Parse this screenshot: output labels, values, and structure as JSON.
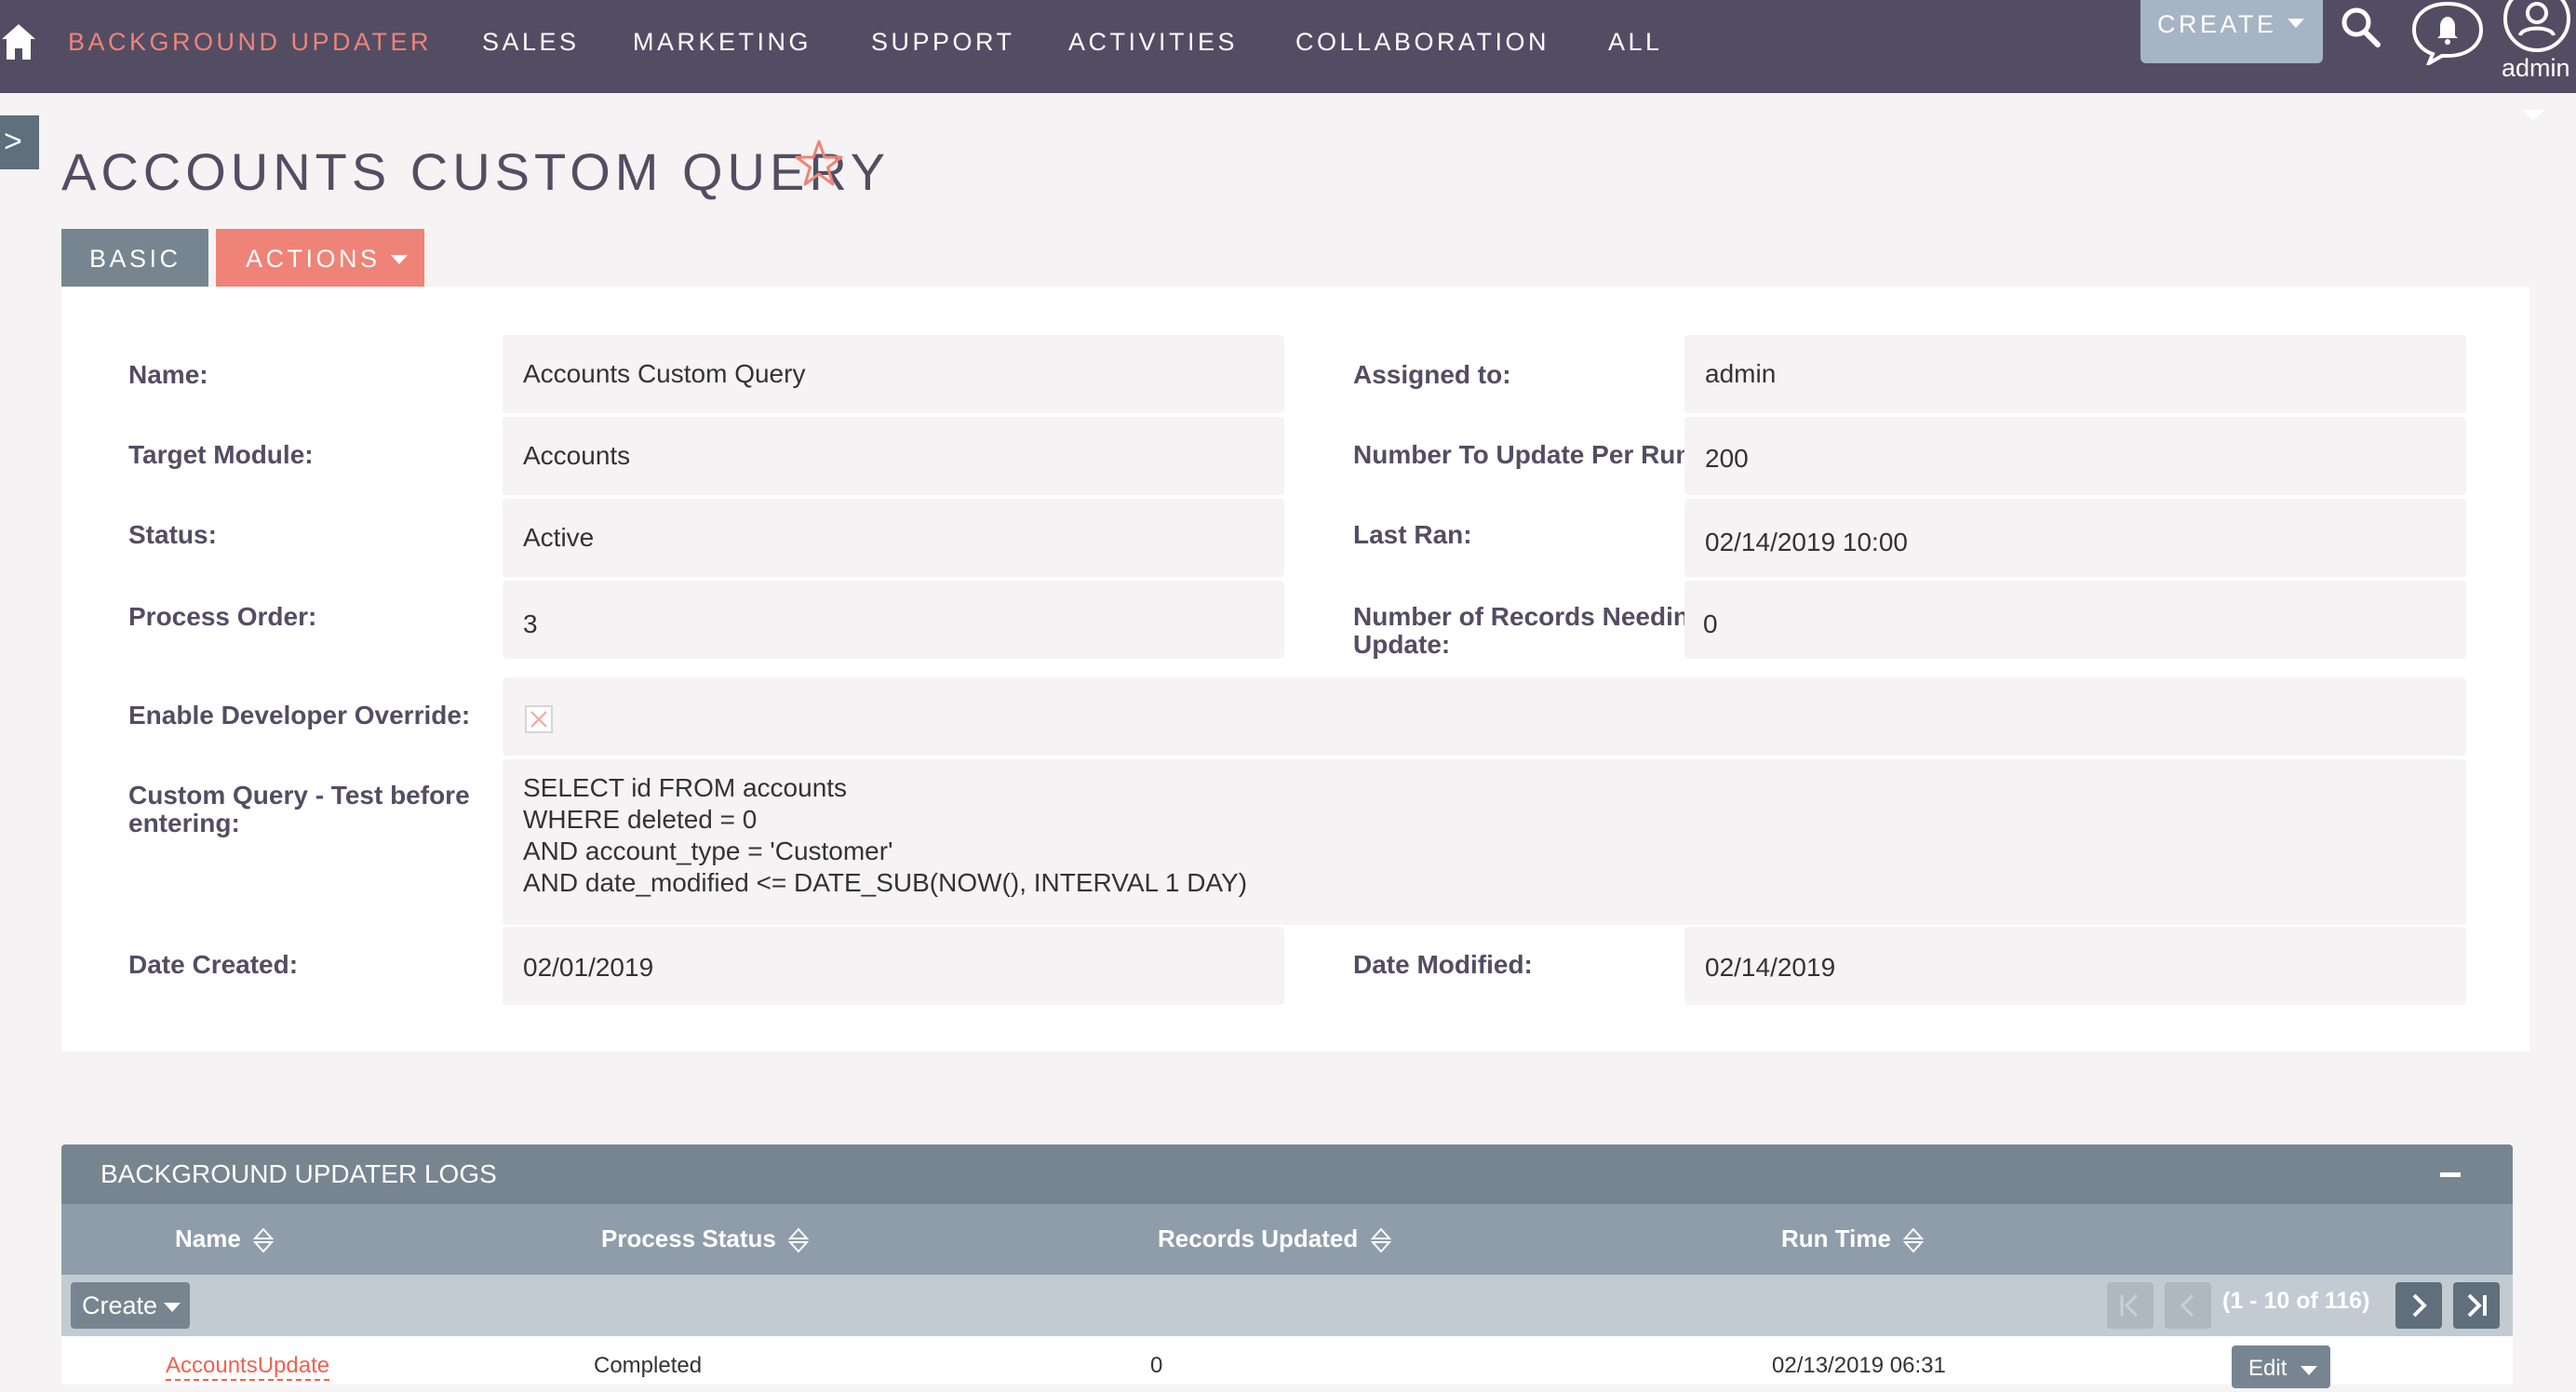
{
  "nav": {
    "items": [
      {
        "label": "BACKGROUND UPDATER",
        "active": true
      },
      {
        "label": "SALES",
        "active": false
      },
      {
        "label": "MARKETING",
        "active": false
      },
      {
        "label": "SUPPORT",
        "active": false
      },
      {
        "label": "ACTIVITIES",
        "active": false
      },
      {
        "label": "COLLABORATION",
        "active": false
      },
      {
        "label": "ALL",
        "active": false
      }
    ],
    "create_label": "CREATE",
    "user_label": "admin",
    "icons": [
      "home-icon",
      "search-icon",
      "notification-bell-icon",
      "user-avatar-icon"
    ]
  },
  "sidebar_toggle": ">",
  "page": {
    "title": "ACCOUNTS CUSTOM QUERY",
    "favorite_icon": "star-outline-icon"
  },
  "tabs": {
    "basic": "BASIC",
    "actions": "ACTIONS"
  },
  "detail": {
    "name_label": "Name:",
    "name_value": "Accounts Custom Query",
    "assigned_label": "Assigned to:",
    "assigned_value": "admin",
    "target_label": "Target Module:",
    "target_value": "Accounts",
    "per_run_label": "Number To Update Per Run:",
    "per_run_value": "200",
    "status_label": "Status:",
    "status_value": "Active",
    "last_ran_label": "Last Ran:",
    "last_ran_value": "02/14/2019 10:00",
    "order_label": "Process Order:",
    "order_value": "3",
    "needing_label_line1": "Number of Records Needing",
    "needing_label_line2": "Update:",
    "needing_value": "0",
    "override_label": "Enable Developer Override:",
    "override_checked": false,
    "query_label_line1": "Custom Query - Test before",
    "query_label_line2": "entering:",
    "query_lines": [
      "SELECT id FROM accounts",
      "WHERE deleted = 0",
      "AND account_type = 'Customer'",
      "AND date_modified <= DATE_SUB(NOW(), INTERVAL 1 DAY)"
    ],
    "created_label": "Date Created:",
    "created_value": "02/01/2019",
    "modified_label": "Date Modified:",
    "modified_value": "02/14/2019"
  },
  "logs": {
    "title": "BACKGROUND UPDATER LOGS",
    "columns": [
      "Name",
      "Process Status",
      "Records Updated",
      "Run Time"
    ],
    "create_label": "Create",
    "pagination": "(1 - 10 of 116)",
    "rows": [
      {
        "name": "AccountsUpdate",
        "status": "Completed",
        "records": "0",
        "run_time": "02/13/2019 06:31",
        "edit_label": "Edit"
      }
    ]
  },
  "colors": {
    "nav_bg": "#534d64",
    "accent": "#f08377",
    "tab_basic": "#778591",
    "panel_header": "#778591"
  }
}
